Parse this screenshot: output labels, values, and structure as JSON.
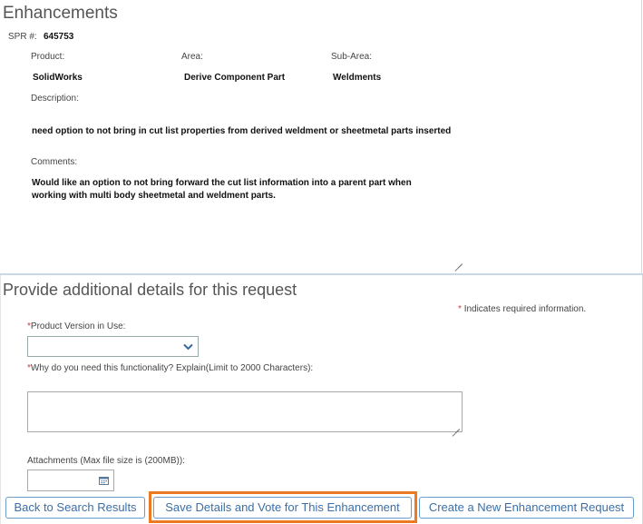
{
  "enhancements": {
    "title": "Enhancements",
    "spr_label": "SPR #:",
    "spr_value": "645753",
    "product_label": "Product:",
    "product_value": "SolidWorks",
    "area_label": "Area:",
    "area_value": "Derive Component Part",
    "subarea_label": "Sub-Area:",
    "subarea_value": "Weldments",
    "description_label": "Description:",
    "description_value": "need option to not bring in cut list properties from derived weldment or sheetmetal parts inserted",
    "comments_label": "Comments:",
    "comments_line1": "Would like an option to not bring forward the cut list information into a parent part when",
    "comments_line2": "working with multi body sheetmetal and weldment parts."
  },
  "details": {
    "title": "Provide additional details for this request",
    "required_note": "Indicates required information.",
    "required_marker": "*",
    "version_label": "Product Version in Use:",
    "version_selected": "",
    "why_label": "Why do you need this functionality? Explain(Limit to 2000 Characters):",
    "why_value": "",
    "attachments_label": "Attachments (Max file size is (200MB)):"
  },
  "buttons": {
    "back": "Back to Search Results",
    "save_vote": "Save Details and Vote for This Enhancement",
    "create": "Create a New Enhancement Request"
  },
  "colors": {
    "accent": "#3b6fa7",
    "highlight": "#ec7a22",
    "required": "#d03a3a"
  },
  "icons": {
    "dropdown": "chevron-down-icon",
    "calendar": "calendar-icon",
    "required": "asterisk-icon"
  }
}
